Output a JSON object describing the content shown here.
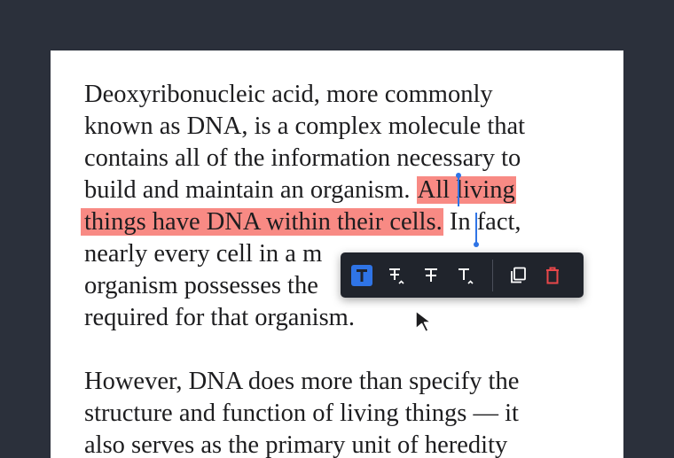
{
  "document": {
    "lines": [
      {
        "text": "Deoxyribonucleic acid, more commonly"
      },
      {
        "text": "known as DNA, is a complex molecule that"
      },
      {
        "text": "contains all of the information necessary to"
      },
      {
        "before": "build and maintain an organism. ",
        "highlight": "All living"
      },
      {
        "highlight": "things have DNA within their cells.",
        "after": " In fact,"
      },
      {
        "text": "nearly every cell in a m"
      },
      {
        "text": "organism possesses the"
      },
      {
        "text": "required for that organism."
      }
    ],
    "paragraph2": [
      "However, DNA does more than specify the",
      "structure and function of living things — it",
      "also serves as the primary unit of heredity"
    ]
  },
  "toolbar": {
    "items": [
      {
        "icon": "highlight-text-icon",
        "active": true
      },
      {
        "icon": "strikeout-caret-icon",
        "active": false
      },
      {
        "icon": "strikeout-icon",
        "active": false
      },
      {
        "icon": "insert-text-icon",
        "active": false
      },
      {
        "icon": "copy-icon",
        "active": false
      },
      {
        "icon": "delete-icon",
        "active": false
      }
    ]
  },
  "colors": {
    "background": "#2b303b",
    "page": "#ffffff",
    "highlight": "#f88a84",
    "accent": "#2f74e6",
    "toolbar": "#20242c",
    "delete": "#e8474a"
  }
}
